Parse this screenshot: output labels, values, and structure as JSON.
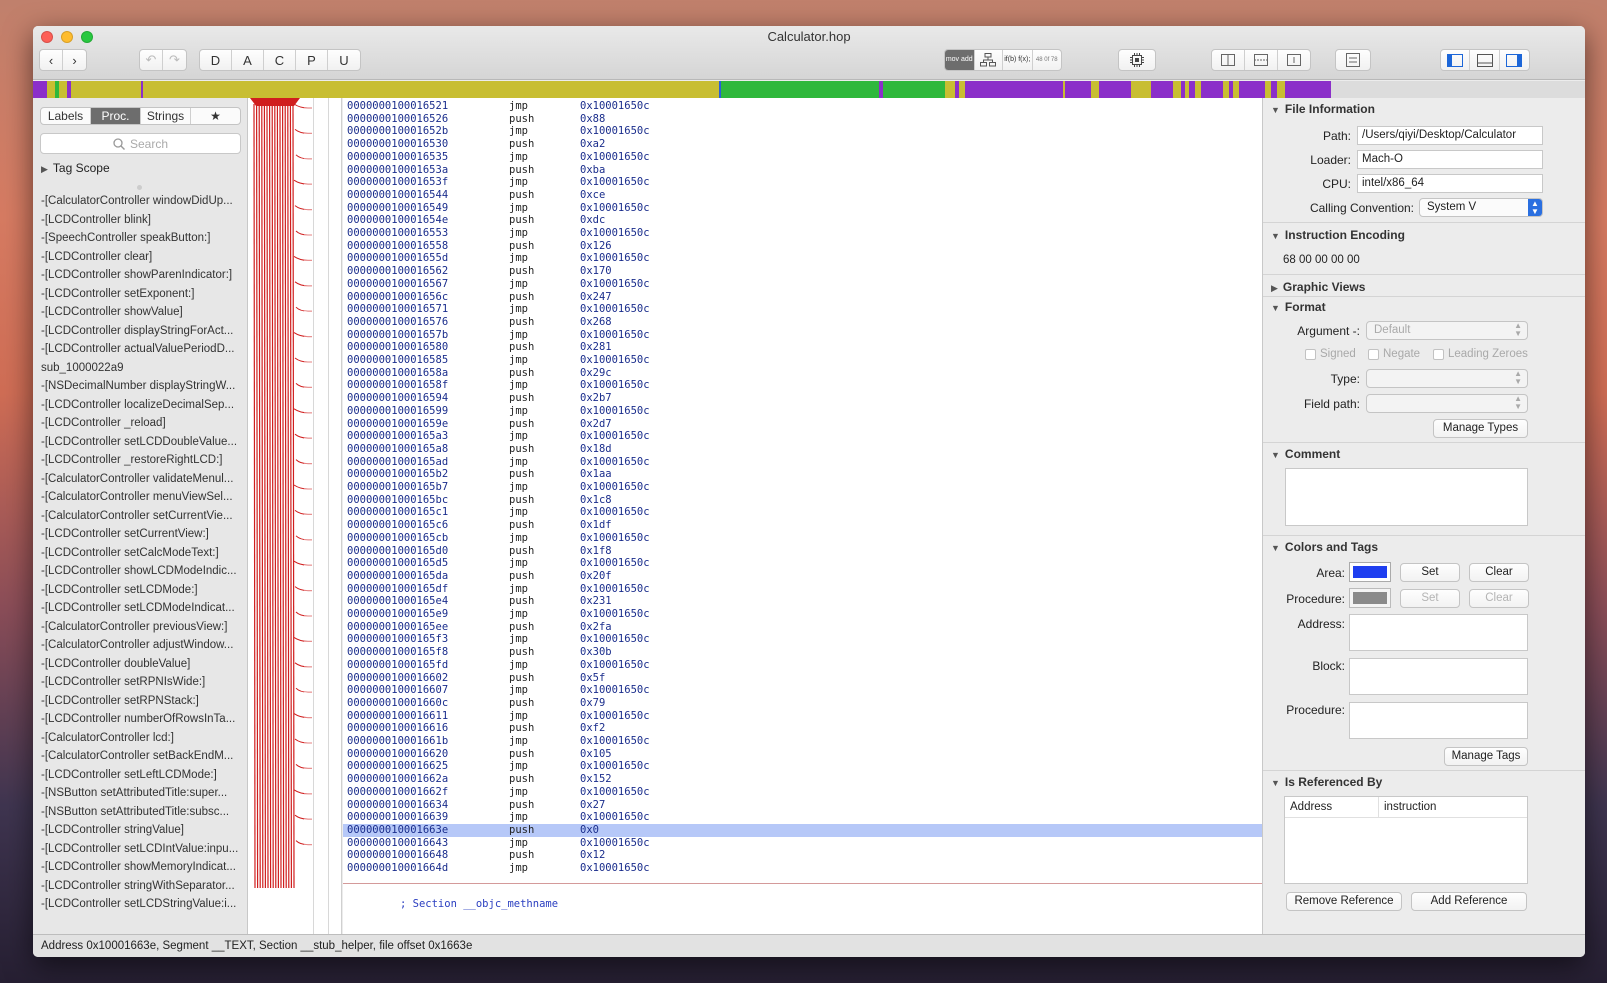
{
  "window": {
    "title": "Calculator.hop"
  },
  "toolbar": {
    "back_icon": "‹",
    "forward_icon": "›",
    "undo_icon": "↶",
    "redo_icon": "↷",
    "type_buttons": [
      "D",
      "A",
      "C",
      "P",
      "U"
    ],
    "mode_asm_label": "mov add",
    "mode_pseudo_label": "if(b) f(x);",
    "mode_hex_label": "48 0f 78"
  },
  "navbar_colors": {
    "data": "#c8be32",
    "code": "#2fb83c",
    "procedure": "#8b2fc9",
    "marker": "#2a5fd8"
  },
  "left_panel": {
    "tabs": [
      "Labels",
      "Proc.",
      "Strings",
      "★"
    ],
    "selected_tab": "Proc.",
    "search_placeholder": "Search",
    "tag_scope": "Tag Scope",
    "procedures": [
      "-[CalculatorController windowDidUp...",
      "-[LCDController blink]",
      "-[SpeechController speakButton:]",
      "-[LCDController clear]",
      "-[LCDController showParenIndicator:]",
      "-[LCDController setExponent:]",
      "-[LCDController showValue]",
      "-[LCDController displayStringForAct...",
      "-[LCDController actualValuePeriodD...",
      "sub_1000022a9",
      "-[NSDecimalNumber displayStringW...",
      "-[LCDController localizeDecimalSep...",
      "-[LCDController _reload]",
      "-[LCDController setLCDDoubleValue...",
      "-[LCDController _restoreRightLCD:]",
      "-[CalculatorController validateMenul...",
      "-[CalculatorController menuViewSel...",
      "-[CalculatorController setCurrentVie...",
      "-[LCDController setCurrentView:]",
      "-[LCDController setCalcModeText:]",
      "-[LCDController showLCDModeIndic...",
      "-[LCDController setLCDMode:]",
      "-[LCDController setLCDModeIndicat...",
      "-[CalculatorController previousView:]",
      "-[CalculatorController adjustWindow...",
      "-[LCDController doubleValue]",
      "-[LCDController setRPNIsWide:]",
      "-[LCDController setRPNStack:]",
      "-[LCDController numberOfRowsInTa...",
      "-[CalculatorController lcd:]",
      "-[CalculatorController setBackEndM...",
      "-[LCDController setLeftLCDMode:]",
      "-[NSButton setAttributedTitle:super...",
      "-[NSButton setAttributedTitle:subsc...",
      "-[LCDController stringValue]",
      "-[LCDController setLCDIntValue:inpu...",
      "-[LCDController showMemoryIndicat...",
      "-[LCDController stringWithSeparator...",
      "-[LCDController setLCDStringValue:i..."
    ]
  },
  "disassembly": {
    "highlight_index": 57,
    "rows": [
      [
        "0000000100016521",
        "jmp",
        "0x10001650c"
      ],
      [
        "0000000100016526",
        "push",
        "0x88"
      ],
      [
        "000000010001652b",
        "jmp",
        "0x10001650c"
      ],
      [
        "0000000100016530",
        "push",
        "0xa2"
      ],
      [
        "0000000100016535",
        "jmp",
        "0x10001650c"
      ],
      [
        "000000010001653a",
        "push",
        "0xba"
      ],
      [
        "000000010001653f",
        "jmp",
        "0x10001650c"
      ],
      [
        "0000000100016544",
        "push",
        "0xce"
      ],
      [
        "0000000100016549",
        "jmp",
        "0x10001650c"
      ],
      [
        "000000010001654e",
        "push",
        "0xdc"
      ],
      [
        "0000000100016553",
        "jmp",
        "0x10001650c"
      ],
      [
        "0000000100016558",
        "push",
        "0x126"
      ],
      [
        "000000010001655d",
        "jmp",
        "0x10001650c"
      ],
      [
        "0000000100016562",
        "push",
        "0x170"
      ],
      [
        "0000000100016567",
        "jmp",
        "0x10001650c"
      ],
      [
        "000000010001656c",
        "push",
        "0x247"
      ],
      [
        "0000000100016571",
        "jmp",
        "0x10001650c"
      ],
      [
        "0000000100016576",
        "push",
        "0x268"
      ],
      [
        "000000010001657b",
        "jmp",
        "0x10001650c"
      ],
      [
        "0000000100016580",
        "push",
        "0x281"
      ],
      [
        "0000000100016585",
        "jmp",
        "0x10001650c"
      ],
      [
        "000000010001658a",
        "push",
        "0x29c"
      ],
      [
        "000000010001658f",
        "jmp",
        "0x10001650c"
      ],
      [
        "0000000100016594",
        "push",
        "0x2b7"
      ],
      [
        "0000000100016599",
        "jmp",
        "0x10001650c"
      ],
      [
        "000000010001659e",
        "push",
        "0x2d7"
      ],
      [
        "00000001000165a3",
        "jmp",
        "0x10001650c"
      ],
      [
        "00000001000165a8",
        "push",
        "0x18d"
      ],
      [
        "00000001000165ad",
        "jmp",
        "0x10001650c"
      ],
      [
        "00000001000165b2",
        "push",
        "0x1aa"
      ],
      [
        "00000001000165b7",
        "jmp",
        "0x10001650c"
      ],
      [
        "00000001000165bc",
        "push",
        "0x1c8"
      ],
      [
        "00000001000165c1",
        "jmp",
        "0x10001650c"
      ],
      [
        "00000001000165c6",
        "push",
        "0x1df"
      ],
      [
        "00000001000165cb",
        "jmp",
        "0x10001650c"
      ],
      [
        "00000001000165d0",
        "push",
        "0x1f8"
      ],
      [
        "00000001000165d5",
        "jmp",
        "0x10001650c"
      ],
      [
        "00000001000165da",
        "push",
        "0x20f"
      ],
      [
        "00000001000165df",
        "jmp",
        "0x10001650c"
      ],
      [
        "00000001000165e4",
        "push",
        "0x231"
      ],
      [
        "00000001000165e9",
        "jmp",
        "0x10001650c"
      ],
      [
        "00000001000165ee",
        "push",
        "0x2fa"
      ],
      [
        "00000001000165f3",
        "jmp",
        "0x10001650c"
      ],
      [
        "00000001000165f8",
        "push",
        "0x30b"
      ],
      [
        "00000001000165fd",
        "jmp",
        "0x10001650c"
      ],
      [
        "0000000100016602",
        "push",
        "0x5f"
      ],
      [
        "0000000100016607",
        "jmp",
        "0x10001650c"
      ],
      [
        "000000010001660c",
        "push",
        "0x79"
      ],
      [
        "0000000100016611",
        "jmp",
        "0x10001650c"
      ],
      [
        "0000000100016616",
        "push",
        "0xf2"
      ],
      [
        "000000010001661b",
        "jmp",
        "0x10001650c"
      ],
      [
        "0000000100016620",
        "push",
        "0x105"
      ],
      [
        "0000000100016625",
        "jmp",
        "0x10001650c"
      ],
      [
        "000000010001662a",
        "push",
        "0x152"
      ],
      [
        "000000010001662f",
        "jmp",
        "0x10001650c"
      ],
      [
        "0000000100016634",
        "push",
        "0x27"
      ],
      [
        "0000000100016639",
        "jmp",
        "0x10001650c"
      ],
      [
        "000000010001663e",
        "push",
        "0x0"
      ],
      [
        "0000000100016643",
        "jmp",
        "0x10001650c"
      ],
      [
        "0000000100016648",
        "push",
        "0x12"
      ],
      [
        "000000010001664d",
        "jmp",
        "0x10001650c"
      ]
    ],
    "section_label": "; Section __objc_methname"
  },
  "inspector": {
    "file_info": {
      "header": "File Information",
      "path_label": "Path:",
      "path": "/Users/qiyi/Desktop/Calculator",
      "loader_label": "Loader:",
      "loader": "Mach-O",
      "cpu_label": "CPU:",
      "cpu": "intel/x86_64",
      "cc_label": "Calling Convention:",
      "cc": "System V"
    },
    "encoding": {
      "header": "Instruction Encoding",
      "bytes": "68 00 00 00 00"
    },
    "graphic_views": "Graphic Views",
    "format": {
      "header": "Format",
      "argument_label": "Argument -:",
      "argument": "Default",
      "signed": "Signed",
      "negate": "Negate",
      "leading_zeroes": "Leading Zeroes",
      "type_label": "Type:",
      "field_path_label": "Field path:",
      "manage_types": "Manage Types"
    },
    "comment": {
      "header": "Comment"
    },
    "colors_tags": {
      "header": "Colors and Tags",
      "area_label": "Area:",
      "area_color": "#1f3ff0",
      "procedure_label": "Procedure:",
      "procedure_color": "#8a8a8a",
      "set": "Set",
      "clear": "Clear",
      "address_label": "Address:",
      "block_label": "Block:",
      "procedure2_label": "Procedure:",
      "manage_tags": "Manage Tags"
    },
    "referenced_by": {
      "header": "Is Referenced By",
      "col_address": "Address",
      "col_instruction": "instruction",
      "remove": "Remove Reference",
      "add": "Add Reference"
    }
  },
  "status": "Address 0x10001663e, Segment __TEXT, Section __stub_helper, file offset 0x1663e"
}
